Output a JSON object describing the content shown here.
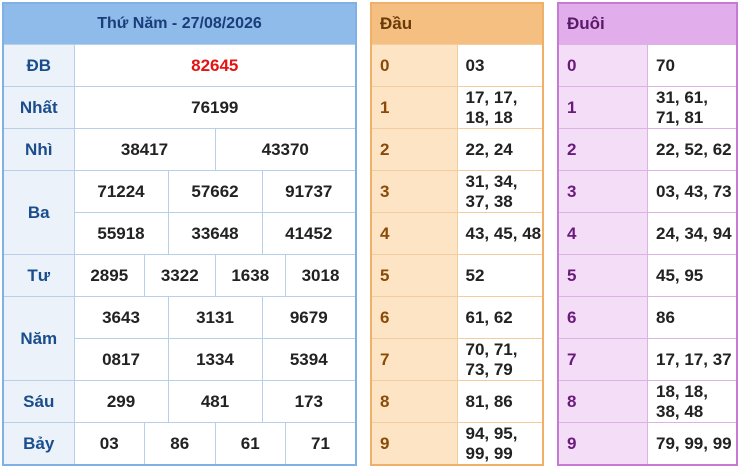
{
  "results": {
    "title": "Thứ Năm - 27/08/2026",
    "db": {
      "label": "ĐB",
      "values": [
        "82645"
      ]
    },
    "nhat": {
      "label": "Nhất",
      "values": [
        "76199"
      ]
    },
    "nhi": {
      "label": "Nhì",
      "values": [
        "38417",
        "43370"
      ]
    },
    "ba": {
      "label": "Ba",
      "values": [
        "71224",
        "57662",
        "91737",
        "55918",
        "33648",
        "41452"
      ]
    },
    "tu": {
      "label": "Tư",
      "values": [
        "2895",
        "3322",
        "1638",
        "3018"
      ]
    },
    "nam": {
      "label": "Năm",
      "values": [
        "3643",
        "3131",
        "9679",
        "0817",
        "1334",
        "5394"
      ]
    },
    "sau": {
      "label": "Sáu",
      "values": [
        "299",
        "481",
        "173"
      ]
    },
    "bay": {
      "label": "Bảy",
      "values": [
        "03",
        "86",
        "61",
        "71"
      ]
    }
  },
  "dau": {
    "header": "Đầu",
    "rows": [
      {
        "key": "0",
        "value": "03"
      },
      {
        "key": "1",
        "value": "17, 17, 18, 18"
      },
      {
        "key": "2",
        "value": "22, 24"
      },
      {
        "key": "3",
        "value": "31, 34, 37, 38"
      },
      {
        "key": "4",
        "value": "43, 45, 48"
      },
      {
        "key": "5",
        "value": "52"
      },
      {
        "key": "6",
        "value": "61, 62"
      },
      {
        "key": "7",
        "value": "70, 71, 73, 79"
      },
      {
        "key": "8",
        "value": "81, 86"
      },
      {
        "key": "9",
        "value": "94, 95, 99, 99"
      }
    ]
  },
  "duoi": {
    "header": "Đuôi",
    "rows": [
      {
        "key": "0",
        "value": "70"
      },
      {
        "key": "1",
        "value": "31, 61, 71, 81"
      },
      {
        "key": "2",
        "value": "22, 52, 62"
      },
      {
        "key": "3",
        "value": "03, 43, 73"
      },
      {
        "key": "4",
        "value": "24, 34, 94"
      },
      {
        "key": "5",
        "value": "45, 95"
      },
      {
        "key": "6",
        "value": "86"
      },
      {
        "key": "7",
        "value": "17, 17, 37"
      },
      {
        "key": "8",
        "value": "18, 18, 38, 48"
      },
      {
        "key": "9",
        "value": "79, 99, 99"
      }
    ]
  }
}
